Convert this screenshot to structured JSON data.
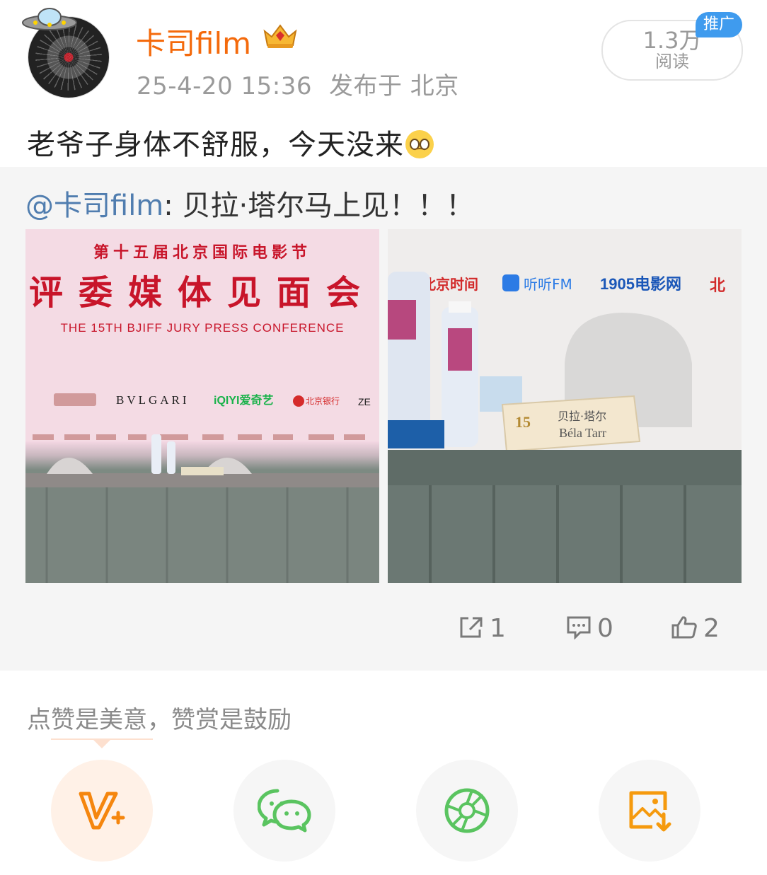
{
  "author": {
    "name": "卡司film",
    "date": "25-4-20 15:36",
    "location": "发布于 北京",
    "vip_icon": "crown-badge-icon",
    "avatar_icon": "ufo-avatar-icon"
  },
  "reads": {
    "count": "1.3万",
    "label": "阅读",
    "badge": "推广"
  },
  "post": {
    "text": "老爷子身体不舒服，今天没来",
    "emoji": "pleading-face-emoji"
  },
  "repost": {
    "mention": "@卡司film",
    "text": ": 贝拉·塔尔马上见！！！",
    "photos": [
      {
        "title_cn": "第十五届北京国际电影节",
        "headline_cn": "评委媒体见面会",
        "headline_en": "THE 15TH BJIFF JURY PRESS CONFERENCE",
        "sponsors": [
          "BVLGARI",
          "iQIYI爱奇艺",
          "北京银行",
          "ZE"
        ]
      },
      {
        "sponsors": [
          "北京时间",
          "听听FM",
          "1905电影网",
          "北"
        ],
        "nameplate_cn": "贝拉·塔尔",
        "nameplate_en": "Béla Tarr",
        "nameplate_num": "15"
      }
    ],
    "actions": {
      "share_count": "1",
      "comment_count": "0",
      "like_count": "2"
    }
  },
  "reward": {
    "label": "点赞是美意，赞赏是鼓励",
    "buttons": [
      "v-plus-icon",
      "wechat-icon",
      "moments-icon",
      "save-image-icon"
    ]
  },
  "colors": {
    "accent": "#f46a0c",
    "link": "#507daf",
    "promo": "#3f9bee",
    "wechat_green": "#5ac460"
  }
}
